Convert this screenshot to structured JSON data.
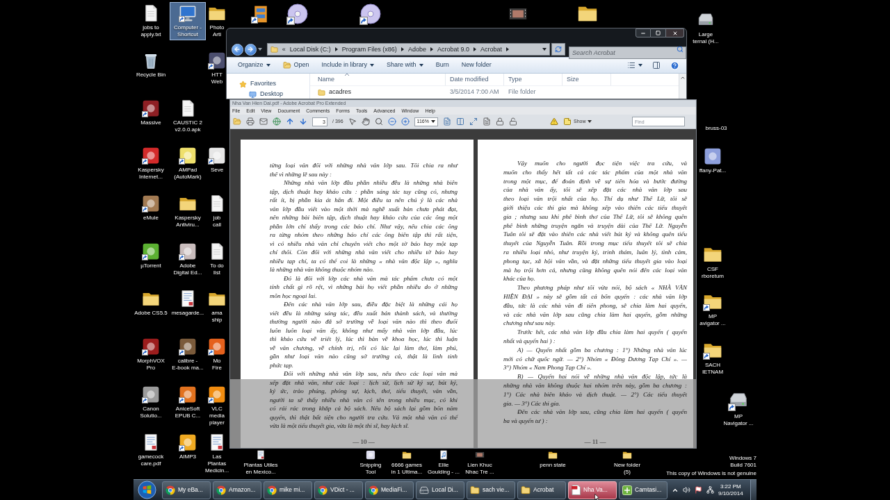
{
  "desktop_icons": [
    {
      "label": "jobs to\napply.txt",
      "kind": "text",
      "shortcut": false,
      "selected": false
    },
    {
      "label": "Recycle Bin",
      "kind": "recycle",
      "shortcut": false,
      "selected": false
    },
    {
      "label": "Massive",
      "kind": "app",
      "color": "#8e1f24",
      "shortcut": true,
      "selected": false
    },
    {
      "label": "Kaspersky\nInternet...",
      "kind": "app",
      "color": "#d32a2a",
      "shortcut": true,
      "selected": false
    },
    {
      "label": "eMule",
      "kind": "app",
      "color": "#a27a52",
      "shortcut": true,
      "selected": false
    },
    {
      "label": "µTorrent",
      "kind": "app",
      "color": "#5bb031",
      "shortcut": true,
      "selected": false
    },
    {
      "label": "Adobe CS5.5",
      "kind": "folder",
      "shortcut": false,
      "selected": false
    },
    {
      "label": "MorphVOX\nPro",
      "kind": "app",
      "color": "#9c1d1d",
      "shortcut": true,
      "selected": false
    },
    {
      "label": "Canon\nSolutio...",
      "kind": "app",
      "color": "#9b9b9b",
      "shortcut": true,
      "selected": false
    },
    {
      "label": "gamecock\ncare.pdf",
      "kind": "document",
      "shortcut": false,
      "selected": false
    },
    {
      "label": "Computer -\nShortcut",
      "kind": "computer",
      "shortcut": true,
      "selected": true
    },
    {
      "label": "CAUSTIC 2\nv2.0.0.apk",
      "kind": "text",
      "shortcut": false,
      "selected": false
    },
    {
      "label": "AMPad\n(AutoMark)",
      "kind": "app",
      "color": "#efe06c",
      "shortcut": true,
      "selected": false
    },
    {
      "label": "Kaspersky\nAntiviru...",
      "kind": "folder",
      "shortcut": false,
      "selected": false
    },
    {
      "label": "Adobe\nDigital Ed...",
      "kind": "app",
      "color": "#c9bcbc",
      "shortcut": true,
      "selected": false
    },
    {
      "label": "mesagarde...",
      "kind": "document",
      "shortcut": false,
      "selected": false
    },
    {
      "label": "calibre -\nE-book ma...",
      "kind": "app",
      "color": "#7b5b3b",
      "shortcut": true,
      "selected": false
    },
    {
      "label": "AniceSoft\nEPUB C...",
      "kind": "app",
      "color": "#e2721f",
      "shortcut": true,
      "selected": false
    },
    {
      "label": "AIMP3",
      "kind": "app",
      "color": "#f0aa22",
      "shortcut": true,
      "selected": false
    },
    {
      "label": "Photo\nArti",
      "kind": "folder",
      "shortcut": false,
      "selected": false
    },
    {
      "label": "HTT\nWeb",
      "kind": "app",
      "color": "#4b4e6e",
      "shortcut": true,
      "selected": false
    },
    {
      "label": "Seve",
      "kind": "app",
      "color": "#e6e6e6",
      "shortcut": true,
      "selected": false
    },
    {
      "label": "job\ncall",
      "kind": "text",
      "shortcut": false,
      "selected": false
    },
    {
      "label": "To do\nlist",
      "kind": "text",
      "shortcut": false,
      "selected": false
    },
    {
      "label": "ama\nship",
      "kind": "folder",
      "shortcut": false,
      "selected": false
    },
    {
      "label": "Mo\nFire",
      "kind": "app",
      "color": "#e5611d",
      "shortcut": true,
      "selected": false
    },
    {
      "label": "VLC media\nplayer",
      "kind": "app",
      "color": "#f08c10",
      "shortcut": true,
      "selected": false
    },
    {
      "label": "Las Plantas\nMedicin...",
      "kind": "document",
      "shortcut": false,
      "selected": false
    },
    {
      "kind": "archive",
      "shortcut": true,
      "selected": false
    },
    {
      "kind": "disc",
      "shortcut": true,
      "selected": false
    },
    {
      "kind": "disc",
      "shortcut": true,
      "selected": false
    },
    {
      "kind": "video",
      "shortcut": false,
      "selected": false
    },
    {
      "kind": "folder",
      "shortcut": false,
      "selected": false
    },
    {
      "label": "Large\nternal (H...",
      "kind": "drive",
      "shortcut": false,
      "selected": false
    },
    {
      "label": "bruss-03",
      "kind": "none",
      "selected": false
    },
    {
      "label": "ffany-Pat...",
      "kind": "app",
      "color": "#8d9fdc",
      "shortcut": false,
      "selected": false
    },
    {
      "label": "CSF\nrboretum",
      "kind": "folder",
      "shortcut": false,
      "selected": false
    },
    {
      "label": "MP\navigator ...",
      "kind": "folder",
      "shortcut": true,
      "selected": false
    },
    {
      "label": "SACH\nIETNAM",
      "kind": "folder",
      "shortcut": true,
      "selected": false
    },
    {
      "label": "MP\nNavigator ...",
      "kind": "drive",
      "shortcut": true,
      "selected": false
    },
    {
      "label": "Plantas Utiles\nen Mexico...",
      "kind": "document",
      "shortcut": false,
      "selected": false
    },
    {
      "label": "Snipping\nTool",
      "kind": "app",
      "color": "#dcdcec",
      "shortcut": false,
      "selected": false
    },
    {
      "label": "6666 games\nin 1 Ultima...",
      "kind": "folder",
      "shortcut": false,
      "selected": false
    },
    {
      "label": "Ellie\nGoulding - ...",
      "kind": "audio",
      "shortcut": false,
      "selected": false
    },
    {
      "label": "Lien Khuc\nNhac Tre ...",
      "kind": "video",
      "shortcut": false,
      "selected": false
    },
    {
      "label": "penn state",
      "kind": "folder",
      "shortcut": false,
      "selected": false
    },
    {
      "label": "New folder\n(5)",
      "kind": "folder",
      "shortcut": false,
      "selected": false
    }
  ],
  "desktop_notice": {
    "edition": "Windows 7\nBuild 7601",
    "warning": "This copy of Windows is not genuine"
  },
  "explorer": {
    "overflow_marker": "«",
    "breadcrumb": [
      "Local Disk (C:)",
      "Program Files (x86)",
      "Adobe",
      "Acrobat 9.0",
      "Acrobat"
    ],
    "search": {
      "placeholder": "Search Acrobat"
    },
    "commands": [
      {
        "label": "Organize",
        "kind": "menu"
      },
      {
        "label": "Open",
        "kind": "open"
      },
      {
        "label": "Include in library",
        "kind": "menu"
      },
      {
        "label": "Share with",
        "kind": "menu"
      },
      {
        "label": "Burn",
        "kind": "plain"
      },
      {
        "label": "New folder",
        "kind": "plain"
      }
    ],
    "nav": [
      {
        "label": "Favorites",
        "kind": "favorites"
      },
      {
        "label": "Desktop",
        "kind": "desktop"
      }
    ],
    "columns": [
      "Name",
      "Date modified",
      "Type",
      "Size"
    ],
    "rows": [
      {
        "name": "acadres",
        "date_modified": "3/5/2014 7:00 AM",
        "type": "File folder"
      }
    ]
  },
  "acrobat": {
    "title": "Nha Van Hien Dai.pdf - Adobe Acrobat Pro Extended",
    "menu": [
      "File",
      "Edit",
      "View",
      "Document",
      "Comments",
      "Forms",
      "Tools",
      "Advanced",
      "Window",
      "Help"
    ],
    "toolbar": {
      "page": "3",
      "page_count": "/ 396",
      "zoom": "116%",
      "show": "Show",
      "find": {
        "placeholder": "Find"
      }
    },
    "pages": [
      {
        "number": "— 10 —",
        "paragraphs": [
          {
            "continued": true,
            "lines": [
              "từng loại văn đối với những nhà văn lớp sau. Tôi chia ra như",
              "thế vì những lẽ sau này :"
            ]
          },
          {
            "continued": false,
            "lines": [
              "Những nhà văn lớp đầu phần nhiều đều là những nhà biên",
              "tập, dịch thuật hay khảo cứu : phần sáng tác tuy cũng có, nhưng",
              "rất ít, bị phần kia át hẳn đi. Một điều ta nên chú ý là các nhà",
              "văn lớp đầu viết vào một thời mà nghề xuất bản chưa phát đạt,",
              "nên những bài biên tập, dịch thuật hay khảo cứu của các ông một",
              "phần lớn chỉ thấy trong các báo chí. Như vậy, nếu chia các ông",
              "ra từng nhóm theo những báo chí các ông biên tập thì rất tiện,",
              "vì có nhiều nhà văn chỉ chuyên viết cho một tờ báo hay một tạp",
              "chí thôi. Còn đối với những nhà văn viết cho nhiều tờ báo hay",
              "nhiều tạp chí, ta có thể coi là những « nhà văn độc lập », nghĩa",
              "là những nhà văn không thuộc nhóm nào."
            ]
          },
          {
            "continued": false,
            "lines": [
              "Đó là đối với lớp các nhà văn mà tác phẩm chưa có một",
              "tính chất gì rõ rệt, vì những bài họ viết phần nhiều do ở những",
              "môn học ngoại lai."
            ]
          },
          {
            "continued": false,
            "lines": [
              "Đến các nhà văn lớp sau, điều đặc biệt là những cái họ",
              "viết đều là những sáng tác, đều xuất bản thành sách, và thường",
              "thường người nào đã sở trường về loại văn nào thì theo đuổi",
              "luôn luôn loại văn ấy, không như mấy nhà văn lớp đầu, lúc",
              "thì khảo cứu về triết lý, lúc thì bàn về khoa học, lúc thì luận",
              "về văn chương, về chính trị, rồi có lúc lại làm thơ, làm phú,",
              "gần như loại văn nào cũng sở trường cả, thật là linh tinh",
              "phức tạp."
            ]
          },
          {
            "continued": false,
            "lines": [
              "Đối với những nhà văn lớp sau, nếu theo các loại văn mà",
              "xếp đặt nhà văn, như các loại : lịch sử, lịch sử ký sự, bút ký,",
              "ký ức, trào phúng, phóng sự, kịch, thơ, tiểu thuyết, văn vần,",
              "người ta sẽ thấy nhiều nhà văn có tên trong nhiều mục, có khi",
              "có rải rác trong khắp cả bộ sách. Nếu bộ sách lại gồm bốn năm",
              "quyển, thì thật bất tiện cho người tra cứu. Vả một nhà văn có thể",
              "vừa là một tiểu thuyết gia, vừa là một thi sĩ, hay kịch sĩ."
            ]
          }
        ]
      },
      {
        "number": "— 11 —",
        "paragraphs": [
          {
            "continued": false,
            "lines": [
              "Vậy muốn cho người đọc tiện việc tra cứu, và",
              "muốn cho thấy hết tất cả các tác phẩm của một nhà văn",
              "trong một mục, để đoán định về sự tiến hóa và bước đường",
              "của nhà văn ấy, tôi sẽ xếp đặt các nhà văn lớp sau",
              "theo loại văn trội nhất của họ. Thí dụ như Thế Lữ, tôi sẽ",
              "giới thiệu các thi gia mà không xếp vào thiên các tiểu thuyết",
              "gia ; nhưng sau khi phê bình thơ của Thế Lữ, tôi sẽ không quên",
              "phê bình những truyện ngắn và truyện dài của Thế Lữ. Nguyễn",
              "Tuân tôi sẽ đặt vào thiên các nhà viết bút ký và không quên tiểu",
              "thuyết của Nguyễn Tuân. Rồi trong mục tiểu thuyết tôi sẽ chia",
              "ra nhiều loại nhỏ, như truyện ký, trinh thám, luân lý, tình cảm,",
              "phong tục, xã hội văn vần, và đặt những tiểu thuyết gia vào loại",
              "mà họ trội hơn cả, nhưng cũng không quên nói đến các loại văn",
              "khác của họ."
            ]
          },
          {
            "continued": false,
            "lines": [
              "Theo phương pháp như tôi vừa nói, bộ sách « NHÀ VĂN",
              "HIỆN ĐẠI » này sẽ gồm tất cả bốn quyển : các nhà văn lớp",
              "đầu, tức là các nhà văn đi tiên phong, sẽ chia làm hai quyển,",
              "và các nhà văn lớp sau cũng chia làm hai quyển, gồm những",
              "chương như sau này."
            ]
          },
          {
            "continued": false,
            "lines": [
              "Trước hết, các nhà văn lớp đầu chia làm hai quyển ( quyển",
              "nhất và quyển hai ) :"
            ]
          },
          {
            "continued": false,
            "lines": [
              "A) — Quyển nhất gồm ba chương : 1°) Những nhà văn lúc",
              "mới có chữ quốc ngữ. — 2°) Nhóm « Đông Dương Tạp Chí ». —",
              "3°) Nhóm « Nam Phong Tạp Chí »."
            ]
          },
          {
            "continued": false,
            "lines": [
              "B) — Quyển hai nói về những nhà văn độc lập, tức là",
              "những nhà văn không thuộc hai nhóm trên này, gồm ba chương :",
              "1°) Các nhà biên khảo và dịch thuật. — 2°) Các tiểu thuyết",
              "gia. — 3°) Các thi gia."
            ]
          },
          {
            "continued": false,
            "lines": [
              "Đến các nhà văn lớp sau, cũng chia làm hai quyển ( quyển",
              "ba và quyển tư ) :"
            ]
          }
        ]
      }
    ]
  },
  "taskbar": {
    "buttons": [
      {
        "label": "My eBa...",
        "kind": "browser",
        "selected": false
      },
      {
        "label": "Amazon...",
        "kind": "browser",
        "selected": false
      },
      {
        "label": "mike mi...",
        "kind": "browser",
        "selected": false
      },
      {
        "label": "VDict - ...",
        "kind": "browser",
        "selected": false
      },
      {
        "label": "MediaFi...",
        "kind": "browser",
        "selected": false
      },
      {
        "label": "Local Di...",
        "kind": "drive",
        "selected": false
      },
      {
        "label": "sach vie...",
        "kind": "folder",
        "selected": false
      },
      {
        "label": "Acrobat",
        "kind": "folder",
        "selected": false
      },
      {
        "label": "Nha Va...",
        "kind": "pdf",
        "selected": true
      },
      {
        "label": "Camtasi...",
        "kind": "app",
        "selected": false
      }
    ],
    "clock": {
      "time": "3:22 PM",
      "date": "9/10/2014"
    }
  }
}
